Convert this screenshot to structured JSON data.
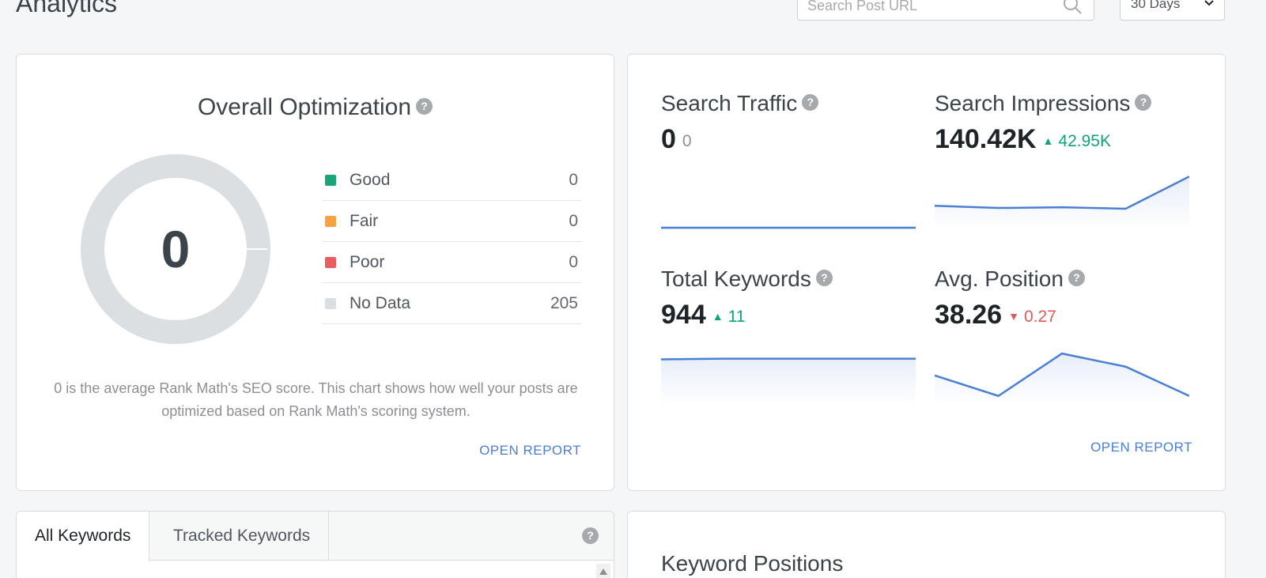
{
  "header": {
    "title": "Analytics",
    "search_placeholder": "Search Post URL",
    "range_value": "30 Days"
  },
  "optimization": {
    "title": "Overall Optimization",
    "score": "0",
    "legend": [
      {
        "label": "Good",
        "value": "0",
        "color": "#1aa47a"
      },
      {
        "label": "Fair",
        "value": "0",
        "color": "#f7a143"
      },
      {
        "label": "Poor",
        "value": "0",
        "color": "#e85d5d"
      },
      {
        "label": "No Data",
        "value": "205",
        "color": "#dcdfe2"
      }
    ],
    "description": "0 is the average Rank Math's SEO score. This chart shows how well your posts are optimized based on Rank Math's scoring system.",
    "open_report": "OPEN REPORT"
  },
  "stats": {
    "traffic": {
      "title": "Search Traffic",
      "value": "0",
      "delta": "0",
      "trend": [
        0,
        0,
        0,
        0,
        0
      ]
    },
    "impressions": {
      "title": "Search Impressions",
      "value": "140.42K",
      "delta": "42.95K",
      "trend": [
        30,
        27,
        28,
        26,
        70
      ]
    },
    "keywords": {
      "title": "Total Keywords",
      "value": "944",
      "delta": "11",
      "trend": [
        60,
        61,
        61,
        61,
        61
      ]
    },
    "position": {
      "title": "Avg. Position",
      "value": "38.26",
      "delta": "0.27",
      "trend": [
        38,
        10,
        68,
        50,
        10
      ]
    },
    "open_report": "OPEN REPORT"
  },
  "keywords_card": {
    "tabs": [
      {
        "label": "All Keywords"
      },
      {
        "label": "Tracked Keywords"
      }
    ]
  },
  "positions_card": {
    "title": "Keyword Positions"
  },
  "colors": {
    "accent": "#4a7fd4",
    "up": "#10a37f",
    "down": "#e05a5a"
  }
}
